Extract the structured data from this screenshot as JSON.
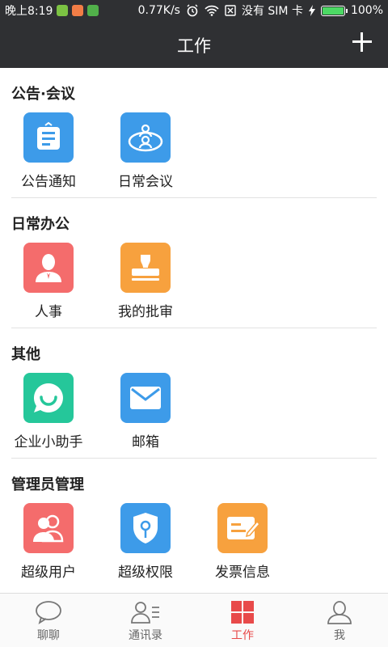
{
  "status_bar": {
    "time": "晚上8:19",
    "network_speed": "0.77K/s",
    "no_sim": "没有 SIM 卡",
    "battery": "100%",
    "battery_level": 1.0
  },
  "header": {
    "title": "工作",
    "add_icon": "plus-icon"
  },
  "sections": [
    {
      "title": "公告·会议",
      "items": [
        {
          "label": "公告通知",
          "icon": "notice-board-icon",
          "color": "#3d9be9"
        },
        {
          "label": "日常会议",
          "icon": "meeting-icon",
          "color": "#3d9be9"
        }
      ]
    },
    {
      "title": "日常办公",
      "items": [
        {
          "label": "人事",
          "icon": "person-icon",
          "color": "#f46c6c"
        },
        {
          "label": "我的批审",
          "icon": "stamp-icon",
          "color": "#f7a13e"
        }
      ]
    },
    {
      "title": "其他",
      "items": [
        {
          "label": "企业小助手",
          "icon": "assistant-chat-icon",
          "color": "#25c79a"
        },
        {
          "label": "邮箱",
          "icon": "mail-icon",
          "color": "#3d9be9"
        }
      ]
    },
    {
      "title": "管理员管理",
      "items": [
        {
          "label": "超级用户",
          "icon": "super-users-icon",
          "color": "#f46c6c"
        },
        {
          "label": "超级权限",
          "icon": "shield-key-icon",
          "color": "#3d9be9"
        },
        {
          "label": "发票信息",
          "icon": "invoice-icon",
          "color": "#f7a13e"
        }
      ]
    }
  ],
  "bottom_nav": [
    {
      "label": "聊聊",
      "icon": "chat-bubble-icon",
      "active": false
    },
    {
      "label": "通讯录",
      "icon": "contacts-icon",
      "active": false
    },
    {
      "label": "工作",
      "icon": "grid-icon",
      "active": true
    },
    {
      "label": "我",
      "icon": "user-icon",
      "active": false
    }
  ],
  "colors": {
    "bar_bg": "#2f3033",
    "active_tab": "#e84a4a",
    "inactive_tab": "#666666"
  }
}
